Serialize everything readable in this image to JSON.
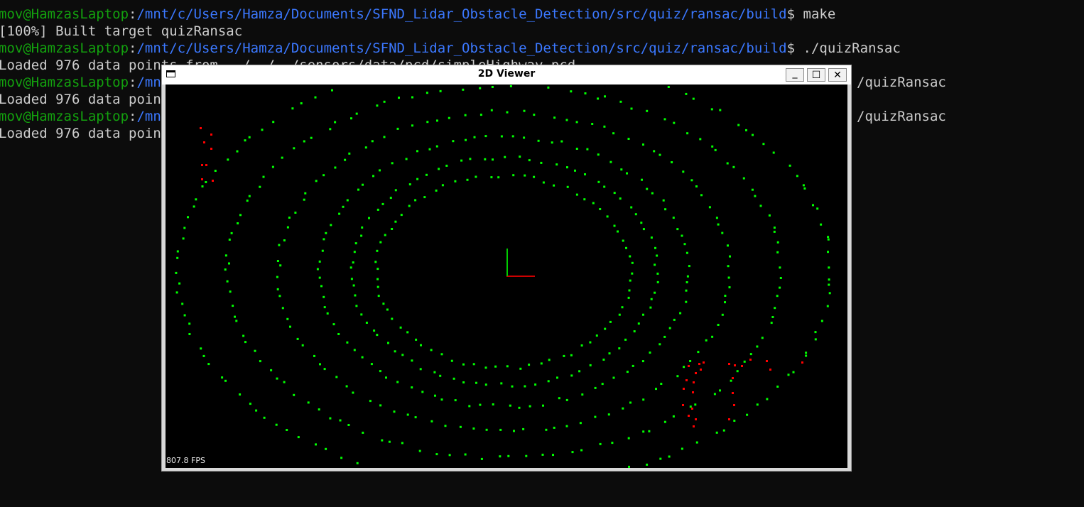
{
  "terminal": {
    "prompt_user": "mov@HamzasLaptop",
    "prompt_colon": ":",
    "prompt_path": "/mnt/c/Users/Hamza/Documents/SFND_Lidar_Obstacle_Detection/src/quiz/ransac/build",
    "prompt_dollar": "$",
    "cmd_make": " make",
    "build_output": "[100%] Built target quizRansac",
    "cmd_run": " ./quizRansac",
    "load_output_partial": "Loaded 976 data points from ../../../sensors/data/pcd/simpleHighway.pcd",
    "load_output_visible": "Loaded 976 data poin",
    "prompt_path_fragment": "/mn",
    "cmd_run_fragment": "/quizRansac"
  },
  "viewer": {
    "title": "2D Viewer",
    "minimize_symbol": "_",
    "maximize_symbol": "☐",
    "close_symbol": "✕",
    "fps": "807.8 FPS",
    "inlier_color": "#00ff00",
    "outlier_color": "#ff0000",
    "axis_x_color": "#cc0000",
    "axis_y_color": "#00cc00"
  }
}
